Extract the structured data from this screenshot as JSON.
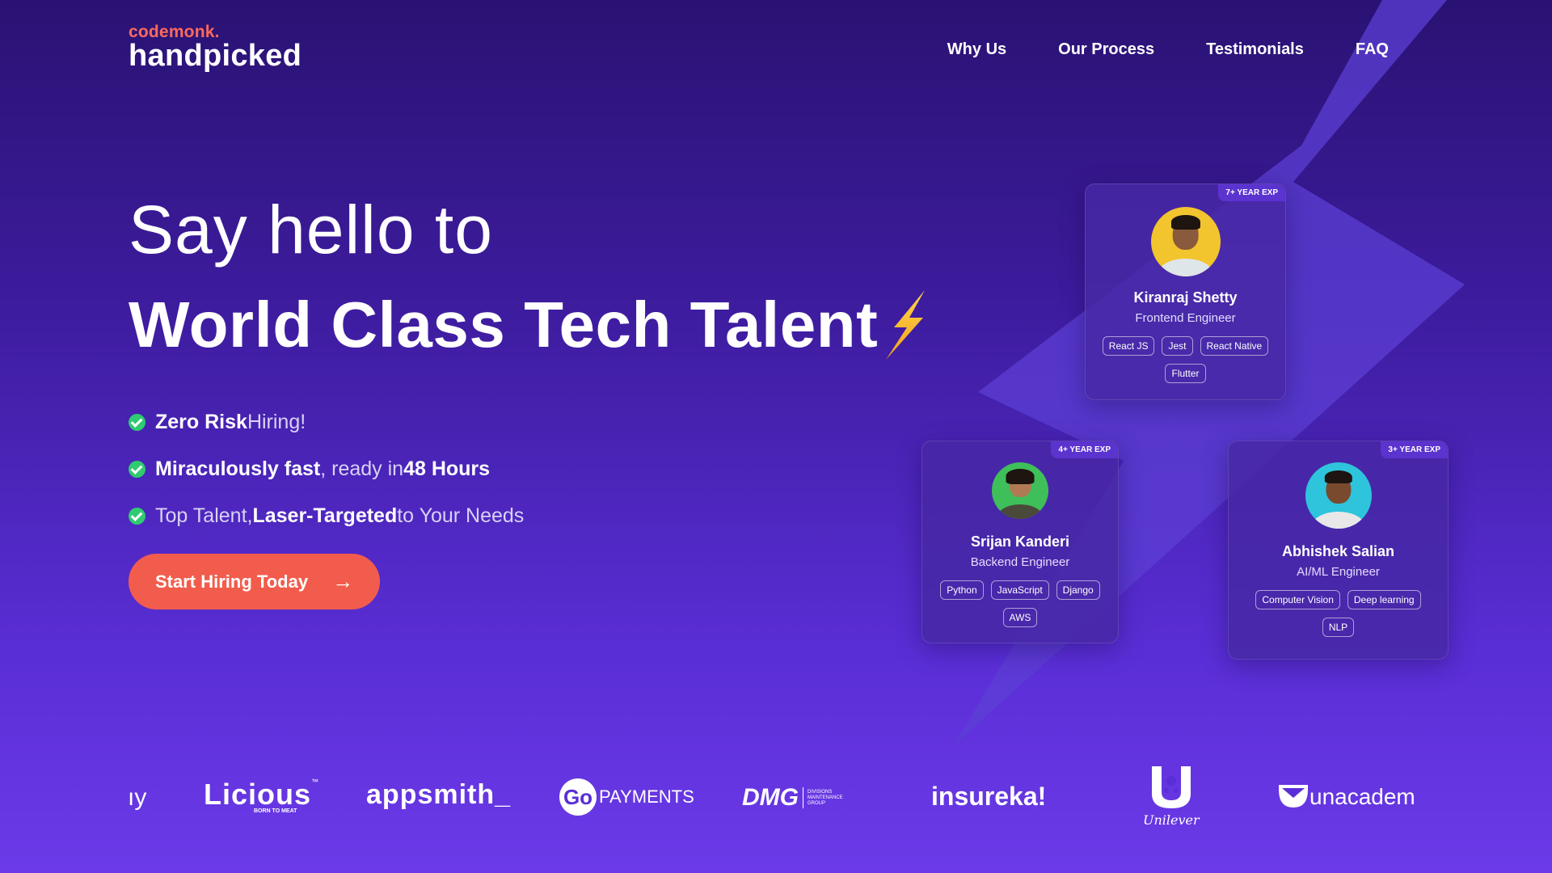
{
  "logo": {
    "brand_top": "codemonk.",
    "brand_main": "handpicked"
  },
  "nav": {
    "items": [
      "Why Us",
      "Our Process",
      "Testimonials",
      "FAQ"
    ]
  },
  "hero": {
    "line1": "Say hello to",
    "line2": "World Class Tech Talent",
    "bullets": [
      {
        "b1": "Zero Risk",
        "t1": " Hiring!",
        "b2": "",
        "t2": ""
      },
      {
        "b1": "Miraculously fast",
        "t1": ", ready in ",
        "b2": "48 Hours",
        "t2": ""
      },
      {
        "b1": "",
        "t1": "Top Talent, ",
        "b2": "Laser-Targeted",
        "t2": " to Your Needs"
      }
    ],
    "cta": "Start Hiring Today",
    "cta_arrow": "→"
  },
  "cards": [
    {
      "exp": "7+ YEAR EXP",
      "name": "Kiranraj Shetty",
      "role": "Frontend Engineer",
      "tags": [
        "React JS",
        "Jest",
        "React Native",
        "Flutter"
      ],
      "avatar_bg": "#f2c52e"
    },
    {
      "exp": "4+ YEAR EXP",
      "name": "Srijan Kanderi",
      "role": "Backend Engineer",
      "tags": [
        "Python",
        "JavaScript",
        "Django",
        "AWS"
      ],
      "avatar_bg": "#3fbf5a"
    },
    {
      "exp": "3+ YEAR EXP",
      "name": "Abhishek Salian",
      "role": "AI/ML Engineer",
      "tags": [
        "Computer Vision",
        "Deep learning",
        "NLP"
      ],
      "avatar_bg": "#2ec4dc"
    }
  ],
  "clients": {
    "partial": "ıy",
    "licious": "Licious",
    "licious_tm": "™",
    "licious_sub": "BORN TO MEAT",
    "appsmith": "appsmith_",
    "go": "Go",
    "payments": "PAYMENTS",
    "dmg": "DMG",
    "dmg_sub": "DIVISIONS MAINTENANCE GROUP",
    "insureka": "insureka!",
    "unilever": "Unilever",
    "unacademy": "unacadem"
  },
  "colors": {
    "accent": "#f25c4c",
    "check": "#2ecb71",
    "logo_top": "#ff6a5a"
  }
}
